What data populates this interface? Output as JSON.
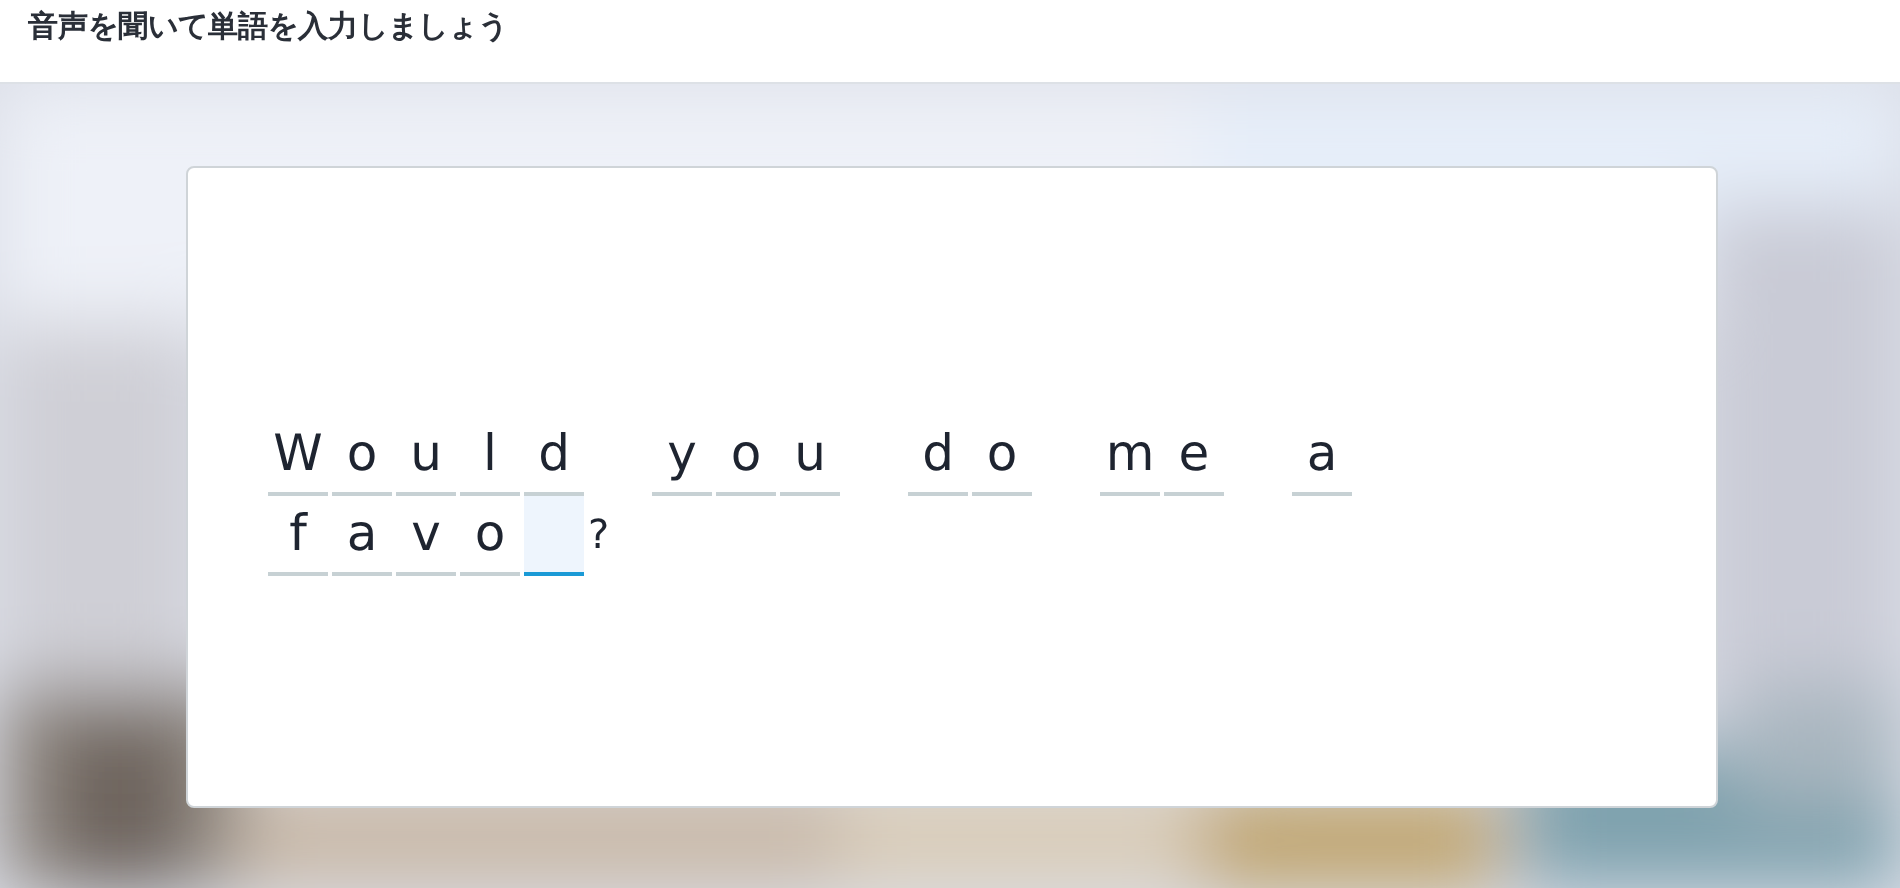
{
  "header": {
    "title": "音声を聞いて単語を入力しましょう"
  },
  "items": [
    {
      "kind": "word",
      "letters": [
        {
          "char": "W",
          "selected": false
        },
        {
          "char": "o",
          "selected": false
        },
        {
          "char": "u",
          "selected": false
        },
        {
          "char": "l",
          "selected": false
        },
        {
          "char": "d",
          "selected": false
        }
      ]
    },
    {
      "kind": "word",
      "letters": [
        {
          "char": "y",
          "selected": false
        },
        {
          "char": "o",
          "selected": false
        },
        {
          "char": "u",
          "selected": false
        }
      ]
    },
    {
      "kind": "word",
      "letters": [
        {
          "char": "d",
          "selected": false
        },
        {
          "char": "o",
          "selected": false
        }
      ]
    },
    {
      "kind": "word",
      "letters": [
        {
          "char": "m",
          "selected": false
        },
        {
          "char": "e",
          "selected": false
        }
      ]
    },
    {
      "kind": "word",
      "letters": [
        {
          "char": "a",
          "selected": false
        }
      ]
    },
    {
      "kind": "word",
      "letters": [
        {
          "char": "f",
          "selected": false
        },
        {
          "char": "a",
          "selected": false
        },
        {
          "char": "v",
          "selected": false
        },
        {
          "char": "o",
          "selected": false
        },
        {
          "selected": true
        }
      ]
    },
    {
      "kind": "mark",
      "text": "?"
    }
  ]
}
